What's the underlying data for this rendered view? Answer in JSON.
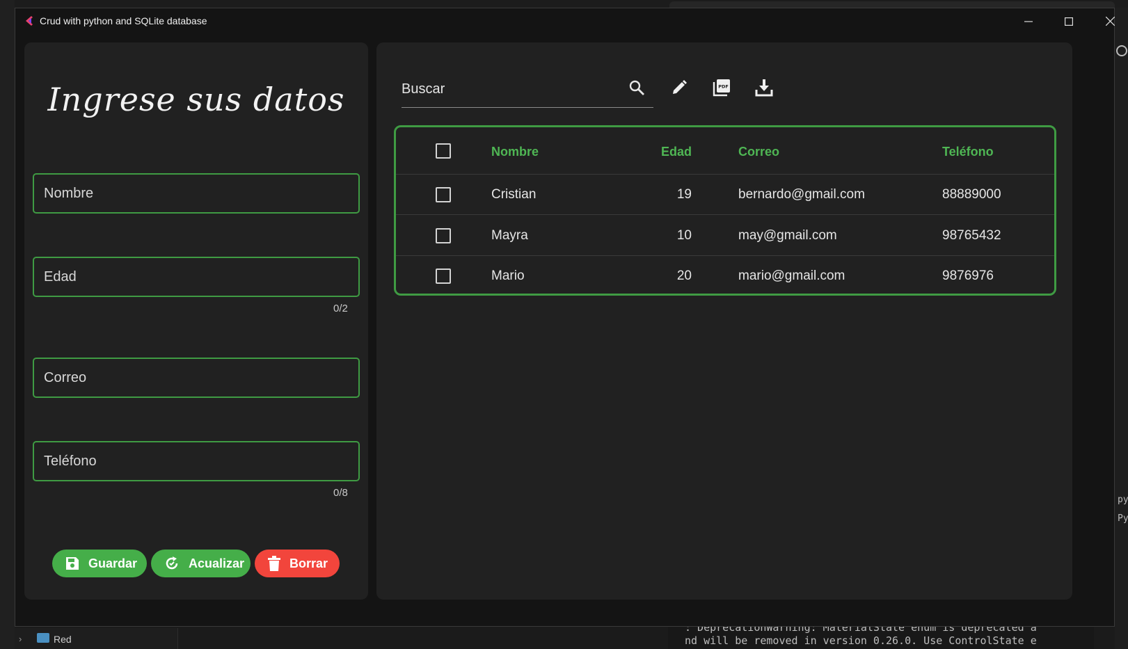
{
  "window": {
    "title": "Crud with python and SQLite database",
    "accent_color": "#45ae49",
    "danger_color": "#f2453c"
  },
  "form": {
    "heading": "Ingrese sus datos",
    "fields": {
      "nombre": {
        "placeholder": "Nombre"
      },
      "edad": {
        "placeholder": "Edad",
        "counter": "0/2"
      },
      "correo": {
        "placeholder": "Correo"
      },
      "telefono": {
        "placeholder": "Teléfono",
        "counter": "0/8"
      }
    },
    "buttons": {
      "guardar": {
        "label": "Guardar",
        "icon": "save-icon"
      },
      "actualizar": {
        "label": "Acualizar",
        "icon": "refresh-icon"
      },
      "borrar": {
        "label": "Borrar",
        "icon": "trash-icon"
      }
    }
  },
  "toolbar": {
    "search_placeholder": "Buscar",
    "icons": [
      "search-icon",
      "edit-icon",
      "pdf-icon",
      "download-icon"
    ]
  },
  "table": {
    "columns": [
      "Nombre",
      "Edad",
      "Correo",
      "Teléfono"
    ],
    "rows": [
      {
        "nombre": "Cristian",
        "edad": "19",
        "correo": "bernardo@gmail.com",
        "telefono": "88889000"
      },
      {
        "nombre": "Mayra",
        "edad": "10",
        "correo": "may@gmail.com",
        "telefono": "98765432"
      },
      {
        "nombre": "Mario",
        "edad": "20",
        "correo": "mario@gmail.com",
        "telefono": "9876976"
      }
    ]
  },
  "background": {
    "explorer_item": "Red",
    "terminal_lines": [
      ": DeprecationWarning: MaterialState enum is deprecated a",
      "nd will be removed in version 0.26.0. Use ControlState e"
    ],
    "side_labels": [
      "py",
      "Py"
    ]
  }
}
